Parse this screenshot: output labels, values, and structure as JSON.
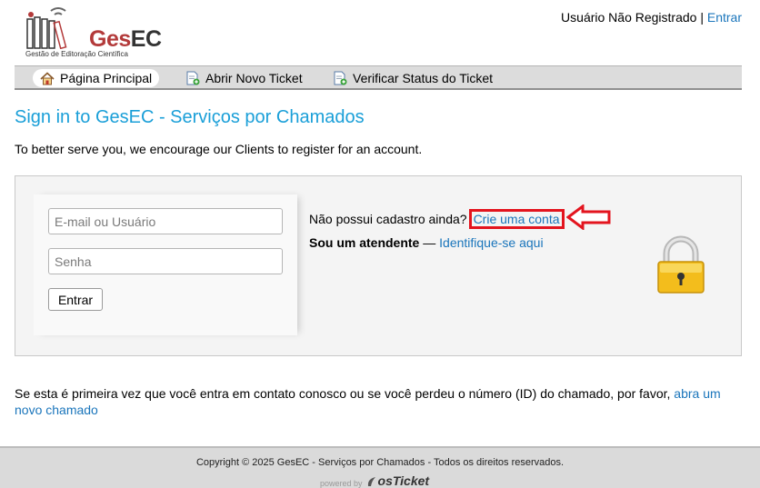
{
  "header": {
    "logo_name": "GesEC",
    "logo_name_prefix": "Ges",
    "logo_name_suffix": "EC",
    "logo_subtitle": "Gestão de Editoração Científica",
    "user_status": "Usuário Não Registrado",
    "separator": "|",
    "login_link": "Entrar"
  },
  "nav": {
    "items": [
      {
        "label": "Página Principal",
        "icon": "home-icon",
        "active": true
      },
      {
        "label": "Abrir Novo Ticket",
        "icon": "new-ticket-icon",
        "active": false
      },
      {
        "label": "Verificar Status do Ticket",
        "icon": "ticket-status-icon",
        "active": false
      }
    ]
  },
  "main": {
    "title": "Sign in to GesEC - Serviços por Chamados",
    "intro": "To better serve you, we encourage our Clients to register for an account.",
    "login": {
      "user_placeholder": "E-mail ou Usuário",
      "password_placeholder": "Senha",
      "submit_label": "Entrar"
    },
    "register_prompt": "Não possui cadastro ainda?",
    "register_link": "Crie uma conta",
    "agent_label": "Sou um atendente",
    "agent_dash": "—",
    "agent_link": "Identifique-se aqui",
    "note_text": "Se esta é primeira vez que você entra em contato conosco ou se você perdeu o número (ID) do chamado, por favor,",
    "note_link": "abra um novo chamado"
  },
  "footer": {
    "copyright": "Copyright © 2025 GesEC - Serviços por Chamados - Todos os direitos reservados.",
    "powered_by": "powered by",
    "brand": "osTicket"
  },
  "colors": {
    "accent": "#1a9fd8",
    "link": "#1a75bb",
    "highlight": "#e3141e",
    "logo_red": "#b33a3a"
  }
}
